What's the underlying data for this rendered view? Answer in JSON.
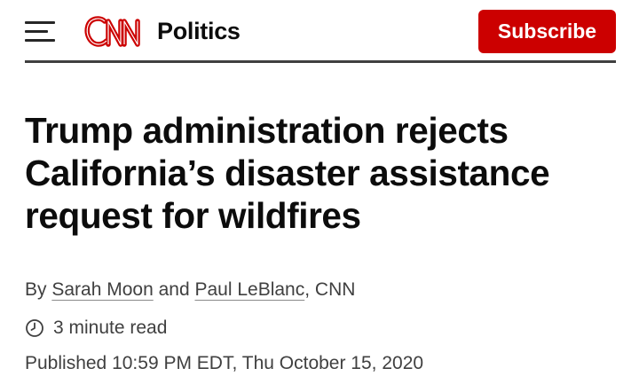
{
  "header": {
    "logo_text": "CNN",
    "section": "Politics",
    "subscribe_label": "Subscribe"
  },
  "colors": {
    "brand_red": "#cc0000",
    "text_dark": "#0c0c0c",
    "text_gray": "#404040"
  },
  "icons": {
    "menu": "hamburger-menu-icon",
    "logo": "cnn-logo",
    "clock": "clock-icon"
  },
  "article": {
    "headline_lines": [
      "Trump administration rejects",
      "California’s disaster assistance",
      "request for wildfires"
    ],
    "byline": {
      "prefix": "By ",
      "author1": "Sarah Moon",
      "conjunction": " and ",
      "author2": "Paul LeBlanc",
      "suffix": ", CNN"
    },
    "read_time": "3 minute read",
    "published": "Published 10:59 PM EDT, Thu October 15, 2020"
  }
}
